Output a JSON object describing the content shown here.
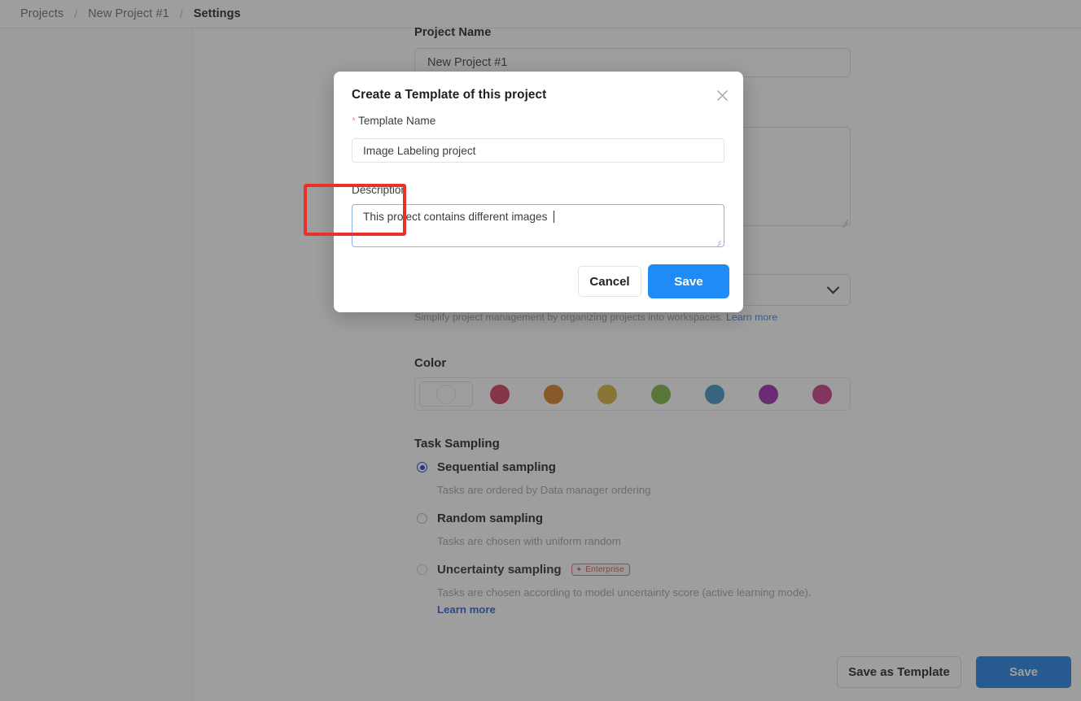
{
  "breadcrumb": {
    "items": [
      "Projects",
      "New Project #1",
      "Settings"
    ],
    "separator": "/"
  },
  "background_form": {
    "project_name": {
      "label": "Project Name",
      "value": "New Project #1"
    },
    "description": {
      "label": "Description",
      "value": ""
    },
    "workspace": {
      "value": "",
      "hint_text": "Simplify project management by organizing projects into workspaces.",
      "hint_link": "Learn more"
    },
    "color": {
      "label": "Color",
      "none_option": "no-color",
      "swatches": [
        "#d13a5e",
        "#d97d26",
        "#d9b03c",
        "#7cb342",
        "#3d93c4",
        "#9c27b0",
        "#cf3a87"
      ]
    },
    "task_sampling": {
      "label": "Task Sampling",
      "options": [
        {
          "label": "Sequential sampling",
          "desc": "Tasks are ordered by Data manager ordering",
          "selected": true,
          "disabled": false
        },
        {
          "label": "Random sampling",
          "desc": "Tasks are chosen with uniform random",
          "selected": false,
          "disabled": false
        },
        {
          "label": "Uncertainty sampling",
          "desc": "Tasks are chosen according to model uncertainty score (active learning mode).",
          "selected": false,
          "disabled": true,
          "badge": "Enterprise",
          "link": "Learn more"
        }
      ]
    },
    "footer": {
      "save_as_template_label": "Save as Template",
      "save_label": "Save"
    }
  },
  "modal": {
    "title": "Create a Template of this project",
    "close_icon": "close-icon",
    "template_name": {
      "label": "Template Name",
      "required_marker": "*",
      "value": "Image Labeling project",
      "placeholder": "Template name"
    },
    "description": {
      "label": "Description",
      "value": "This project contains different images ",
      "placeholder": "Description"
    },
    "cancel_label": "Cancel",
    "save_label": "Save"
  },
  "highlight": {
    "target": "modal-save-button",
    "color": "#e8312a"
  }
}
